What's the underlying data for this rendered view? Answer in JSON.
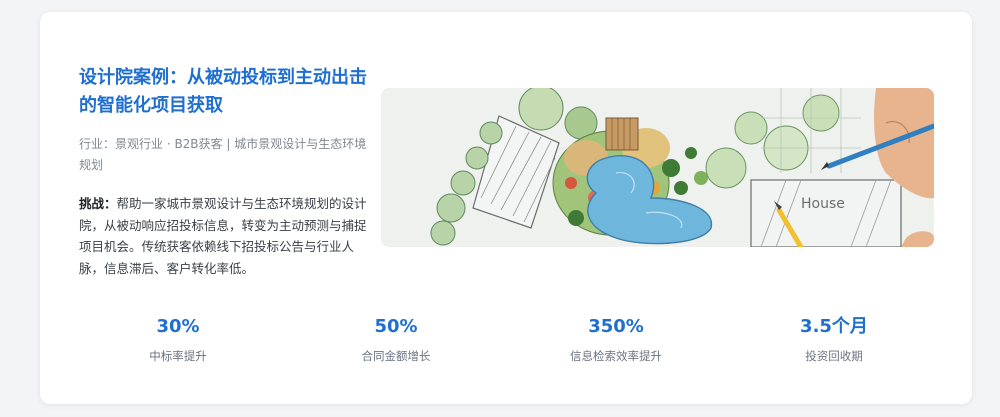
{
  "case": {
    "title": "设计院案例：从被动投标到主动出击的智能化项目获取",
    "meta": "行业：景观行业 · B2B获客 | 城市景观设计与生态环境规划",
    "challenge_label": "挑战：",
    "challenge_text": "帮助一家城市景观设计与生态环境规划的设计院，从被动响应招投标信息，转变为主动预测与捕捉项目机会。传统获客依赖线下招投标公告与行业人脉，信息滞后、客户转化率低。",
    "illustration_text": "House"
  },
  "metrics": [
    {
      "value": "30%",
      "label": "中标率提升"
    },
    {
      "value": "50%",
      "label": "合同金额增长"
    },
    {
      "value": "350%",
      "label": "信息检索效率提升"
    },
    {
      "value": "3.5个月",
      "label": "投资回收期"
    }
  ],
  "colors": {
    "accent": "#1f6fd1",
    "text_muted": "#808892",
    "background": "#f3f4f6"
  }
}
